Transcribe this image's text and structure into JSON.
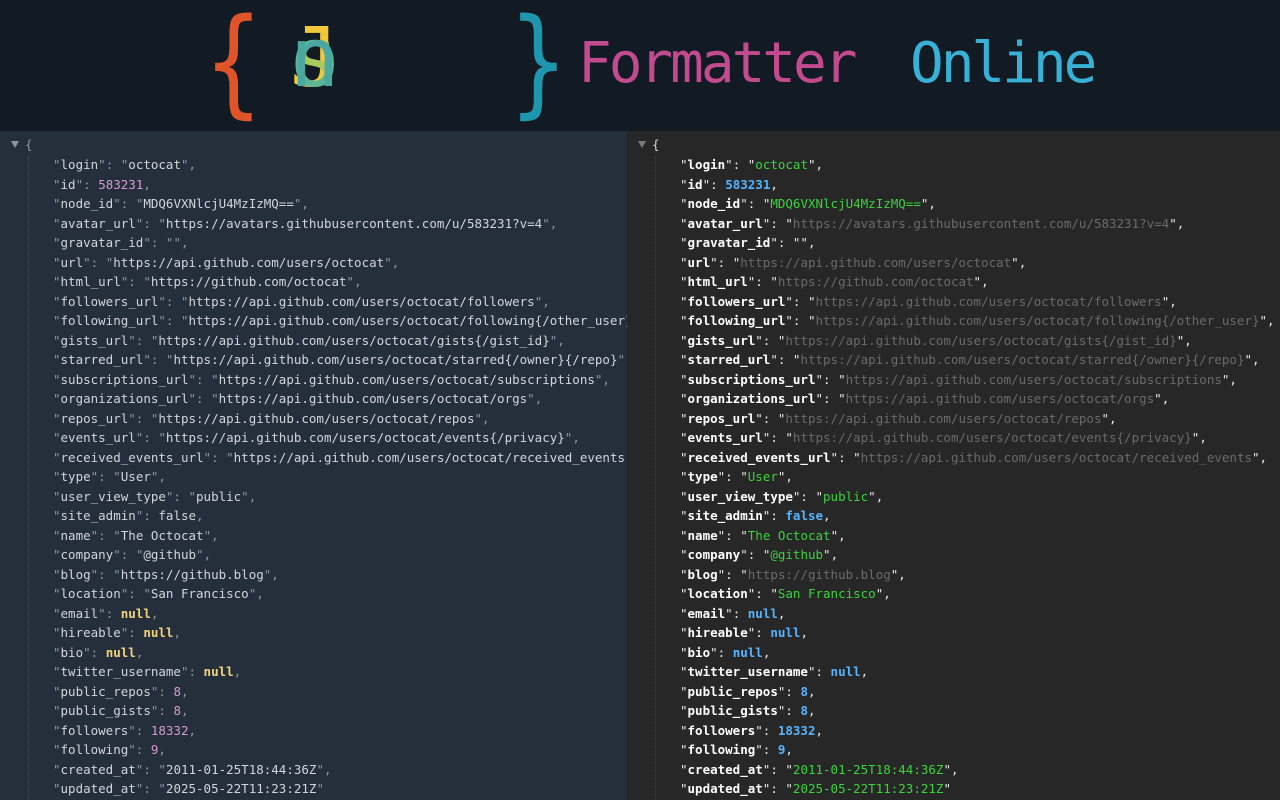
{
  "banner": {
    "open_brace": "{",
    "json_letters": [
      "J",
      "s",
      "o",
      "n"
    ],
    "close_brace": "}",
    "formatter": "Formatter",
    "online": "Online"
  },
  "brace_open": "{",
  "colors": {
    "left_bg": "#252e3b",
    "right_bg": "#272727",
    "banner_bg": "#121a24",
    "right_string": "#3bd33b",
    "right_number": "#55b4ff"
  },
  "fields": [
    {
      "key": "login",
      "value": "octocat",
      "type": "string"
    },
    {
      "key": "id",
      "value": "583231",
      "type": "number"
    },
    {
      "key": "node_id",
      "value": "MDQ6VXNlcjU4MzIzMQ==",
      "type": "string"
    },
    {
      "key": "avatar_url",
      "value": "https://avatars.githubusercontent.com/u/583231?v=4",
      "type": "url"
    },
    {
      "key": "gravatar_id",
      "value": "",
      "type": "string"
    },
    {
      "key": "url",
      "value": "https://api.github.com/users/octocat",
      "type": "url"
    },
    {
      "key": "html_url",
      "value": "https://github.com/octocat",
      "type": "url"
    },
    {
      "key": "followers_url",
      "value": "https://api.github.com/users/octocat/followers",
      "type": "url"
    },
    {
      "key": "following_url",
      "value": "https://api.github.com/users/octocat/following{/other_user}",
      "type": "url"
    },
    {
      "key": "gists_url",
      "value": "https://api.github.com/users/octocat/gists{/gist_id}",
      "type": "url"
    },
    {
      "key": "starred_url",
      "value": "https://api.github.com/users/octocat/starred{/owner}{/repo}",
      "type": "url"
    },
    {
      "key": "subscriptions_url",
      "value": "https://api.github.com/users/octocat/subscriptions",
      "type": "url"
    },
    {
      "key": "organizations_url",
      "value": "https://api.github.com/users/octocat/orgs",
      "type": "url"
    },
    {
      "key": "repos_url",
      "value": "https://api.github.com/users/octocat/repos",
      "type": "url"
    },
    {
      "key": "events_url",
      "value": "https://api.github.com/users/octocat/events{/privacy}",
      "type": "url"
    },
    {
      "key": "received_events_url",
      "value": "https://api.github.com/users/octocat/received_events",
      "type": "url"
    },
    {
      "key": "type",
      "value": "User",
      "type": "string"
    },
    {
      "key": "user_view_type",
      "value": "public",
      "type": "string"
    },
    {
      "key": "site_admin",
      "value": "false",
      "type": "boolean"
    },
    {
      "key": "name",
      "value": "The Octocat",
      "type": "string"
    },
    {
      "key": "company",
      "value": "@github",
      "type": "string"
    },
    {
      "key": "blog",
      "value": "https://github.blog",
      "type": "url"
    },
    {
      "key": "location",
      "value": "San Francisco",
      "type": "string"
    },
    {
      "key": "email",
      "value": "null",
      "type": "null"
    },
    {
      "key": "hireable",
      "value": "null",
      "type": "null"
    },
    {
      "key": "bio",
      "value": "null",
      "type": "null"
    },
    {
      "key": "twitter_username",
      "value": "null",
      "type": "null"
    },
    {
      "key": "public_repos",
      "value": "8",
      "type": "number"
    },
    {
      "key": "public_gists",
      "value": "8",
      "type": "number"
    },
    {
      "key": "followers",
      "value": "18332",
      "type": "number"
    },
    {
      "key": "following",
      "value": "9",
      "type": "number"
    },
    {
      "key": "created_at",
      "value": "2011-01-25T18:44:36Z",
      "type": "string"
    },
    {
      "key": "updated_at",
      "value": "2025-05-22T11:23:21Z",
      "type": "string"
    }
  ]
}
